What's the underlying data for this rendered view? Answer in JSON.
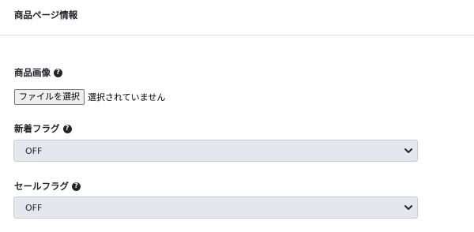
{
  "header": {
    "title": "商品ページ情報"
  },
  "image_field": {
    "label": "商品画像",
    "help_icon": "?",
    "button_label": "ファイルを選択",
    "status_text": "選択されていません"
  },
  "new_flag": {
    "label": "新着フラグ",
    "help_icon": "?",
    "selected": "OFF"
  },
  "sale_flag": {
    "label": "セールフラグ",
    "help_icon": "?",
    "selected": "OFF"
  },
  "icons": {
    "help": "question-circle-icon",
    "select_arrow": "chevron-down-icon"
  }
}
